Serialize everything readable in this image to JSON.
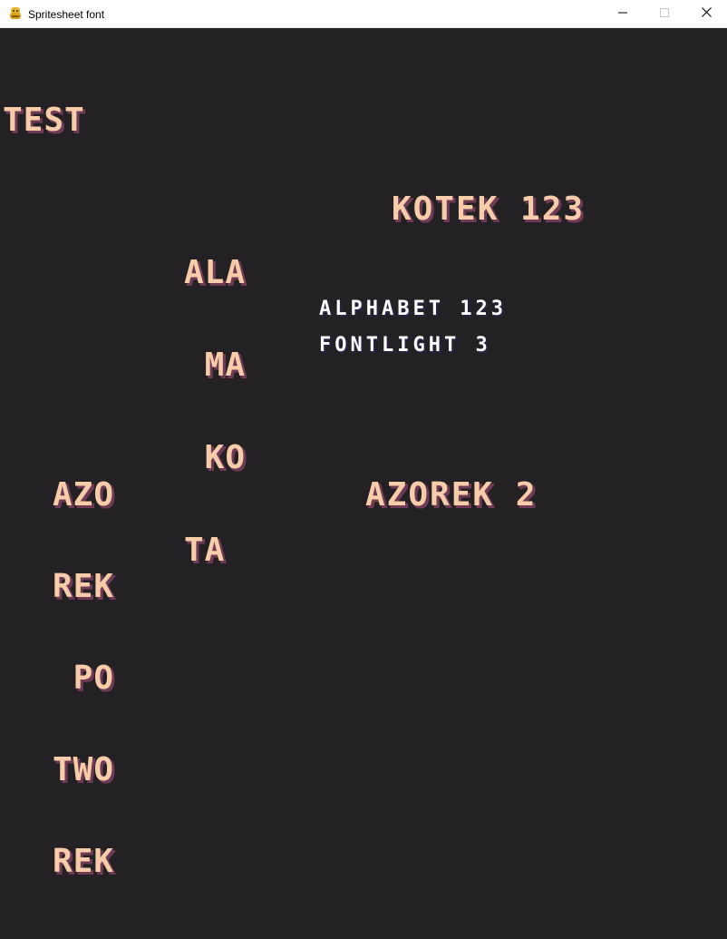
{
  "window": {
    "title": "Spritesheet font",
    "controls": {
      "minimize_icon": "minimize-icon",
      "maximize_icon": "maximize-icon",
      "close_icon": "close-icon"
    }
  },
  "canvas": {
    "background": "#232123",
    "texts": {
      "test": "TEST",
      "kotek": "KOTEK 123",
      "alphabet": "ALPHABET 123",
      "fontlight": "FONTLIGHT 3",
      "azorek2": "AZOREK 2",
      "ala_block": [
        "ALA",
        " MA",
        " KO",
        "TA"
      ],
      "azo_block": [
        "AZO",
        "REK",
        " PO",
        "TWO",
        "REK"
      ]
    },
    "colors": {
      "peach": "#f6cda8",
      "peach_shadow": "#6f3a55",
      "white": "#ffffff",
      "white_shadow": "#2a2344"
    }
  }
}
